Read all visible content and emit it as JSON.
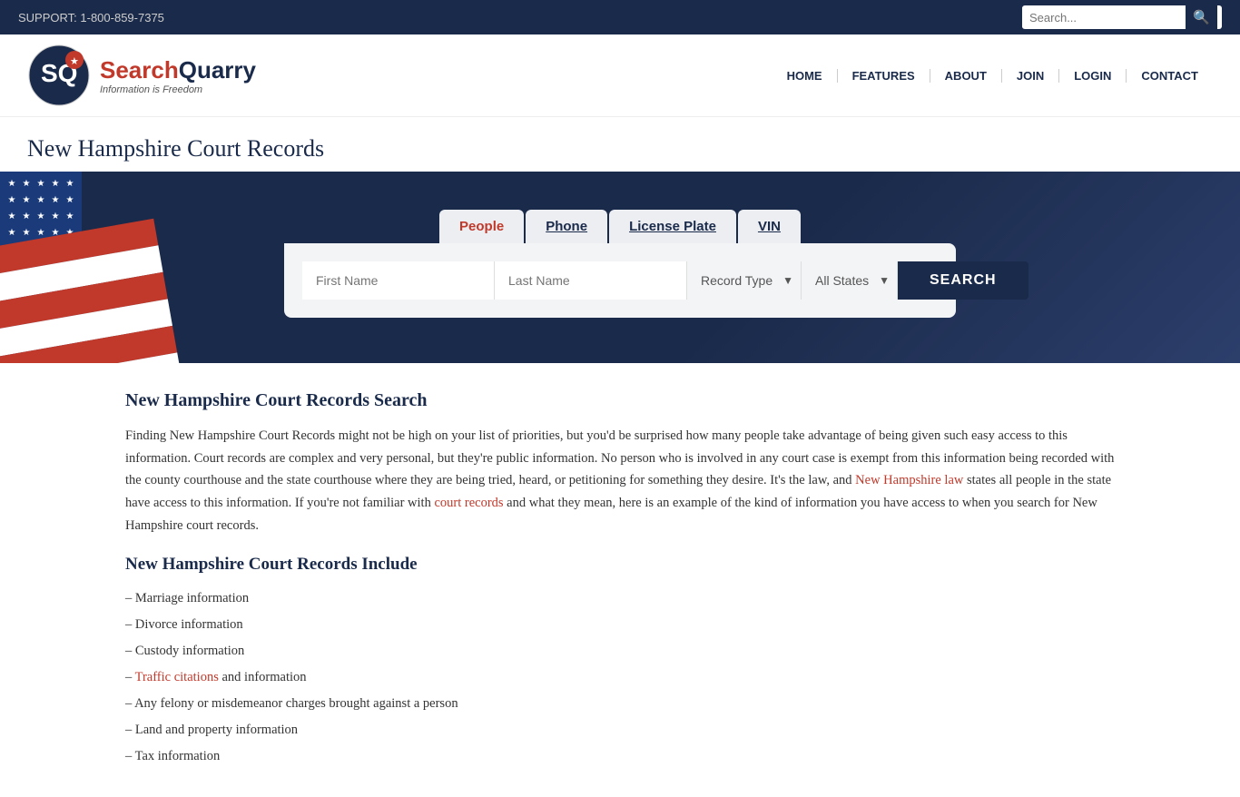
{
  "topbar": {
    "phone": "SUPPORT: 1-800-859-7375",
    "search_placeholder": "Search..."
  },
  "nav": {
    "logo_name_part1": "Search",
    "logo_name_part2": "Quarry",
    "logo_tagline": "Information is Freedom",
    "items": [
      {
        "label": "HOME",
        "href": "#"
      },
      {
        "label": "FEATURES",
        "href": "#"
      },
      {
        "label": "ABOUT",
        "href": "#"
      },
      {
        "label": "JOIN",
        "href": "#"
      },
      {
        "label": "LOGIN",
        "href": "#"
      },
      {
        "label": "CONTACT",
        "href": "#"
      }
    ]
  },
  "page": {
    "title": "New Hampshire Court Records"
  },
  "search": {
    "tabs": [
      {
        "label": "People",
        "active": true
      },
      {
        "label": "Phone",
        "active": false
      },
      {
        "label": "License Plate",
        "active": false
      },
      {
        "label": "VIN",
        "active": false
      }
    ],
    "first_name_placeholder": "First Name",
    "last_name_placeholder": "Last Name",
    "record_type_label": "Record Type",
    "all_states_label": "All States",
    "search_button": "SEARCH"
  },
  "content": {
    "main_heading": "New Hampshire Court Records Search",
    "paragraph1": "Finding New Hampshire Court Records might not be high on your list of priorities, but you'd be surprised how many people take advantage of being given such easy access to this information. Court records are complex and very personal, but they're public information. No person who is involved in any court case is exempt from this information being recorded with the county courthouse and the state courthouse where they are being tried, heard, or petitioning for something they desire. It's the law, and",
    "nh_law_link": "New Hampshire law",
    "paragraph2": "states all people in the state have access to this information. If you're not familiar with",
    "court_records_link": "court records",
    "paragraph3": "and what they mean, here is an example of the kind of information you have access to when you search for New Hampshire court records.",
    "includes_heading": "New Hampshire Court Records Include",
    "list_items": [
      "Marriage information",
      "Divorce information",
      "Custody information",
      "Traffic citations and information",
      "Any felony or misdemeanor charges brought against a person",
      "Land and property information",
      "Tax information"
    ]
  }
}
